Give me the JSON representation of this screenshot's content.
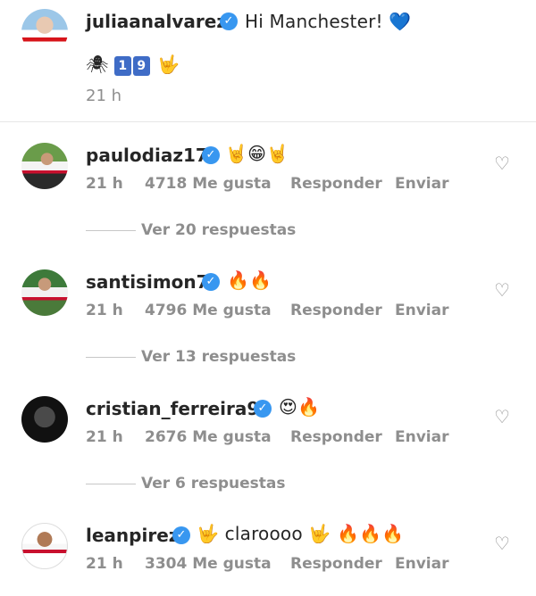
{
  "post": {
    "username": "juliaanalvarez",
    "caption": "Hi Manchester! 💙",
    "emoji_line": [
      "🕷",
      "1",
      "9",
      "🤟"
    ],
    "time": "21 h"
  },
  "comments": [
    {
      "username": "paulodiaz17",
      "text": "🤘😁🤘",
      "time": "21 h",
      "likes": "4718 Me gusta",
      "reply": "Responder",
      "send": "Enviar",
      "view_replies": "Ver 20 respuestas"
    },
    {
      "username": "santisimon7",
      "text": "🔥🔥",
      "time": "21 h",
      "likes": "4796 Me gusta",
      "reply": "Responder",
      "send": "Enviar",
      "view_replies": "Ver 13 respuestas"
    },
    {
      "username": "cristian_ferreira99",
      "text": "😍🔥",
      "time": "21 h",
      "likes": "2676 Me gusta",
      "reply": "Responder",
      "send": "Enviar",
      "view_replies": "Ver 6 respuestas"
    },
    {
      "username": "leanpirez",
      "text": "🤟 claroooo 🤟 🔥🔥🔥",
      "time": "21 h",
      "likes": "3304 Me gusta",
      "reply": "Responder",
      "send": "Enviar"
    }
  ],
  "icons": {
    "verified": "verified-badge-icon",
    "like": "heart-outline-icon"
  },
  "colors": {
    "verified_blue": "#3897f0",
    "text": "#262626",
    "secondary": "#8e8e8e",
    "divider": "#e6e6e6"
  }
}
